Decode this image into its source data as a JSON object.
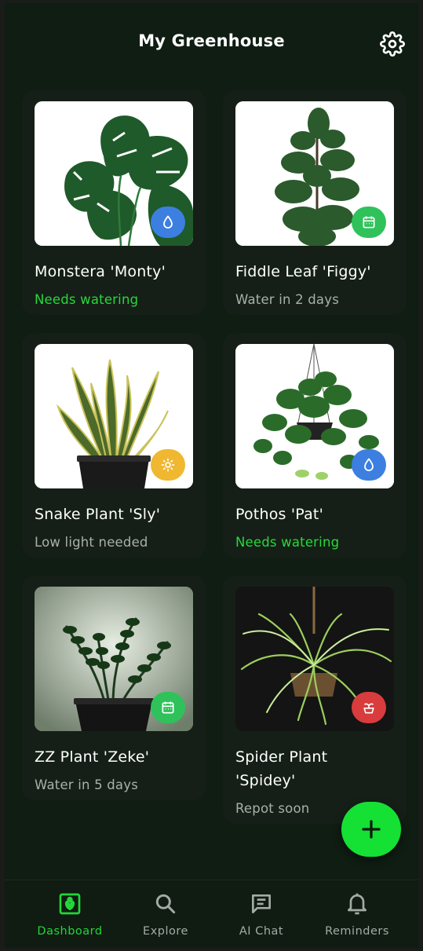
{
  "header": {
    "title": "My Greenhouse",
    "settings_icon": "gear-icon"
  },
  "colors": {
    "accent": "#22d63a",
    "background": "#0f1d12",
    "card": "#151f17",
    "water_badge": "#3c7fe0",
    "calendar_badge": "#2fc25a",
    "sun_badge": "#f0b830",
    "repot_badge": "#d83c3c"
  },
  "plants": [
    {
      "name": "Monstera 'Monty'",
      "status": "Needs watering",
      "status_type": "alert",
      "badge_icon": "water-drop-icon"
    },
    {
      "name": "Fiddle Leaf 'Figgy'",
      "status": "Water in 2 days",
      "status_type": "normal",
      "badge_icon": "calendar-icon"
    },
    {
      "name": "Snake Plant 'Sly'",
      "status": "Low light needed",
      "status_type": "normal",
      "badge_icon": "sun-icon"
    },
    {
      "name": "Pothos 'Pat'",
      "status": "Needs watering",
      "status_type": "alert",
      "badge_icon": "water-drop-icon"
    },
    {
      "name": "ZZ Plant 'Zeke'",
      "status": "Water in 5 days",
      "status_type": "normal",
      "badge_icon": "calendar-icon"
    },
    {
      "name": "Spider Plant 'Spidey'",
      "name_line1": "Spider Plant",
      "name_line2": "'Spidey'",
      "status": "Repot soon",
      "status_type": "normal",
      "badge_icon": "repot-icon"
    }
  ],
  "fab": {
    "icon": "plus-icon"
  },
  "nav": {
    "items": [
      {
        "label": "Dashboard",
        "icon": "dashboard-icon",
        "active": true
      },
      {
        "label": "Explore",
        "icon": "search-icon",
        "active": false
      },
      {
        "label": "AI Chat",
        "icon": "chat-icon",
        "active": false
      },
      {
        "label": "Reminders",
        "icon": "bell-icon",
        "active": false
      }
    ]
  }
}
